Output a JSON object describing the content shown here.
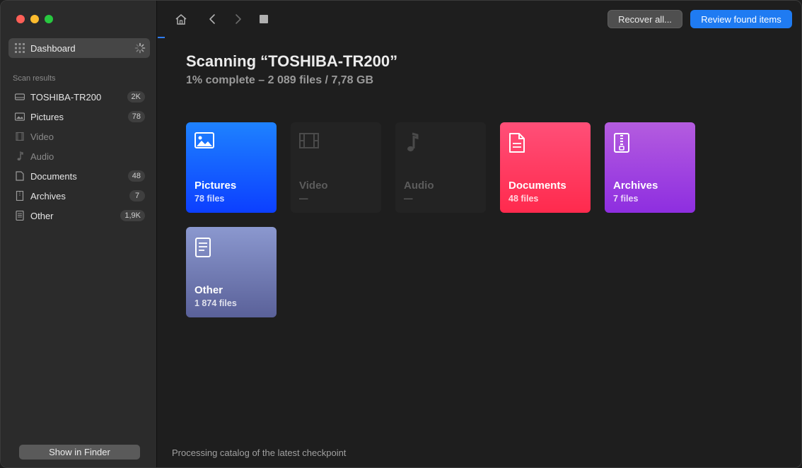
{
  "window": {
    "title": "Scanning “TOSHIBA-TR200”"
  },
  "sidebar": {
    "dashboard_label": "Dashboard",
    "section_label": "Scan results",
    "items": [
      {
        "label": "TOSHIBA-TR200",
        "badge": "2K",
        "icon": "drive-icon"
      },
      {
        "label": "Pictures",
        "badge": "78",
        "icon": "picture-icon"
      },
      {
        "label": "Video",
        "badge": "",
        "icon": "film-icon"
      },
      {
        "label": "Audio",
        "badge": "",
        "icon": "music-note-icon"
      },
      {
        "label": "Documents",
        "badge": "48",
        "icon": "document-icon"
      },
      {
        "label": "Archives",
        "badge": "7",
        "icon": "archive-icon"
      },
      {
        "label": "Other",
        "badge": "1,9K",
        "icon": "other-file-icon"
      }
    ],
    "finder_button": "Show in Finder"
  },
  "toolbar": {
    "recover_label": "Recover all...",
    "review_label": "Review found items"
  },
  "main": {
    "title": "Scanning “TOSHIBA-TR200”",
    "subtitle": "1% complete – 2 089 files / 7,78 GB",
    "progress_percent": 1,
    "tiles": [
      {
        "name": "Pictures",
        "count": "78 files",
        "color": "#1e82ff"
      },
      {
        "name": "Video",
        "count": "—",
        "color": "#232323"
      },
      {
        "name": "Audio",
        "count": "—",
        "color": "#232323"
      },
      {
        "name": "Documents",
        "count": "48 files",
        "color": "#ff3a5e"
      },
      {
        "name": "Archives",
        "count": "7 files",
        "color": "#a445df"
      },
      {
        "name": "Other",
        "count": "1 874 files",
        "color": "#7480b8"
      }
    ]
  },
  "status_text": "Processing catalog of the latest checkpoint",
  "colors": {
    "accent": "#1f7bf2",
    "traffic_red": "#fe5f57",
    "traffic_yellow": "#febc2e",
    "traffic_green": "#28c840"
  }
}
